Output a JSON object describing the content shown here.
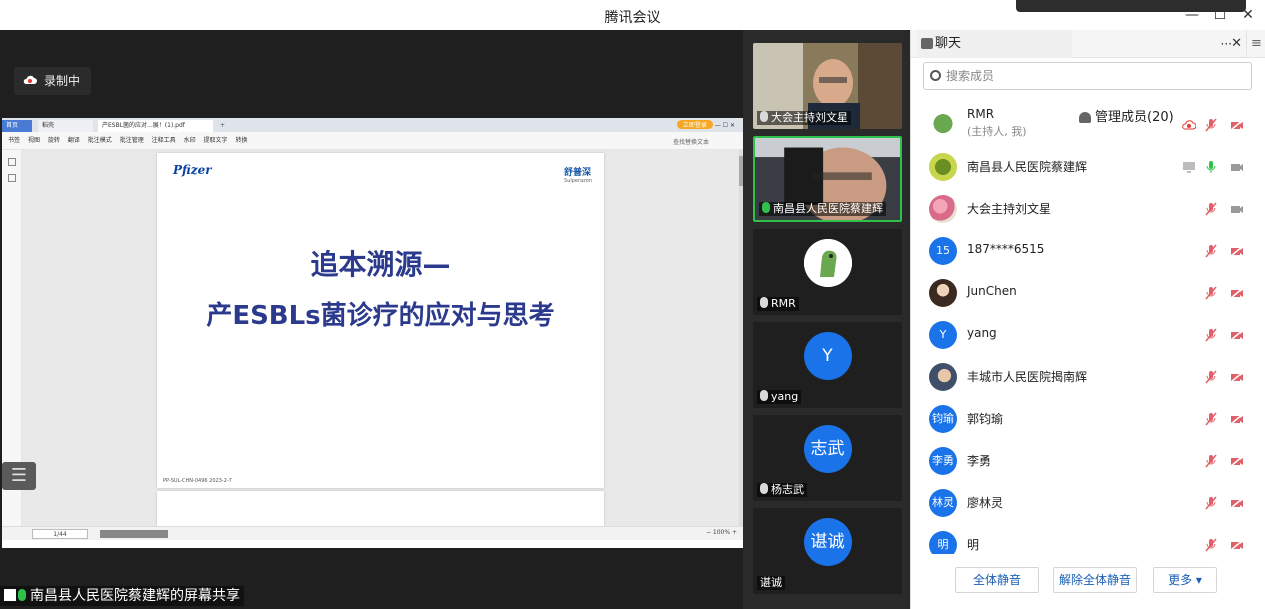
{
  "window": {
    "title": "腾讯会议"
  },
  "recording": {
    "label": "录制中"
  },
  "share": {
    "label": "南昌县人民医院蔡建辉的屏幕共享",
    "wps": {
      "tabs": [
        "首页",
        "稻壳",
        "产ESBL菌的应对...展！(1).pdf",
        "+"
      ],
      "right_label": "立即登录",
      "toolbar": [
        "书签",
        "视图",
        "旋转",
        "翻译",
        "批注模式",
        "批注管理",
        "注释工具",
        "水印",
        "提取文字",
        "转换"
      ],
      "search_placeholder": "查找替换文本",
      "page_indicator": "1/44",
      "zoom": "100%"
    },
    "slide": {
      "logo_left": "Pfizer",
      "logo_right": "舒普深",
      "logo_right_sub": "Sulperazon",
      "title_line1": "追本溯源—",
      "title_line2": "产ESBLs菌诊疗的应对与思考",
      "footer": "PP-SUL-CHN-0496 2023-2-7"
    }
  },
  "videos": [
    {
      "name": "大会主持刘文星",
      "mic": "off",
      "type": "camera"
    },
    {
      "name": "南昌县人民医院蔡建辉",
      "mic": "on",
      "type": "camera",
      "active": true
    },
    {
      "name": "RMR",
      "mic": "off",
      "type": "avatar"
    },
    {
      "name": "yang",
      "mic": "off",
      "type": "initial",
      "initial": "Y"
    },
    {
      "name": "杨志武",
      "mic": "off",
      "type": "initial",
      "initial": "志武"
    },
    {
      "name": "谌诚",
      "mic": "none",
      "type": "initial",
      "initial": "谌诚"
    }
  ],
  "panel": {
    "tabs": {
      "chat": "聊天",
      "members": "管理成员(20)",
      "more": "···"
    },
    "search_placeholder": "搜索成员",
    "members": [
      {
        "name": "RMR",
        "sub": "(主持人, 我)",
        "avatar": "img1",
        "icons": [
          "rec",
          "mic-off",
          "cam-off"
        ]
      },
      {
        "name": "南昌县人民医院蔡建辉",
        "avatar": "img2",
        "icons": [
          "screen",
          "mic-on",
          "cam"
        ]
      },
      {
        "name": "大会主持刘文星",
        "avatar": "img3",
        "icons": [
          "mic-off",
          "cam"
        ]
      },
      {
        "name": "187****6515",
        "avatar": "blue",
        "initial": "15",
        "icons": [
          "mic-off",
          "cam-off"
        ]
      },
      {
        "name": "JunChen",
        "avatar": "img4",
        "icons": [
          "mic-off",
          "cam-off"
        ]
      },
      {
        "name": "yang",
        "avatar": "blue",
        "initial": "Y",
        "icons": [
          "mic-off",
          "cam-off"
        ]
      },
      {
        "name": "丰城市人民医院揭南辉",
        "avatar": "img5",
        "icons": [
          "mic-off",
          "cam-off"
        ]
      },
      {
        "name": "郭钧瑜",
        "avatar": "blue",
        "initial": "钧瑜",
        "icons": [
          "mic-off",
          "cam-off"
        ]
      },
      {
        "name": "李勇",
        "avatar": "blue",
        "initial": "李勇",
        "icons": [
          "mic-off",
          "cam-off"
        ]
      },
      {
        "name": "廖林灵",
        "avatar": "blue",
        "initial": "林灵",
        "icons": [
          "mic-off",
          "cam-off"
        ]
      },
      {
        "name": "明",
        "avatar": "blue",
        "initial": "明",
        "icons": [
          "mic-off",
          "cam-off"
        ]
      }
    ],
    "buttons": {
      "mute_all": "全体静音",
      "unmute_all": "解除全体静音",
      "more": "更多 ▾"
    }
  },
  "colors": {
    "accent": "#1a73e8",
    "mic_on": "#2ec24a",
    "mic_off": "#e0606a",
    "slide_title": "#2b3a8c"
  }
}
